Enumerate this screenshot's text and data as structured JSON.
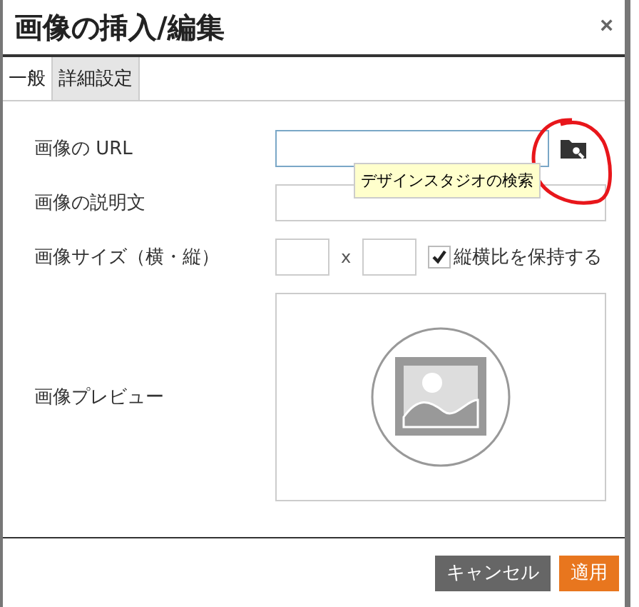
{
  "dialog": {
    "title": "画像の挿入/編集",
    "close": "×"
  },
  "tabs": [
    {
      "label": "一般",
      "selected": false
    },
    {
      "label": "詳細設定",
      "selected": true
    }
  ],
  "url_field": {
    "label": "画像の URL",
    "tooltip": "デザインスタジオの検索"
  },
  "description_field": {
    "label": "画像の説明文"
  },
  "size": {
    "label": "画像サイズ（横・縦）",
    "separator": "x",
    "keep_ratio": {
      "label": "縦横比を保持する",
      "checked": true
    }
  },
  "preview": {
    "label": "画像プレビュー"
  },
  "buttons": [
    {
      "label": "キャンセル",
      "kind": "cancel"
    },
    {
      "label": "適用",
      "kind": "primary"
    }
  ]
}
